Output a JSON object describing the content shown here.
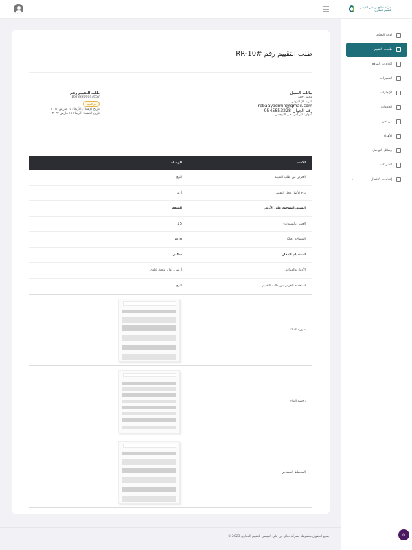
{
  "header": {
    "logo_text": "شركة صالح بن علي العيسى للتقييم العقاري"
  },
  "sidebar": {
    "items": [
      {
        "label": "لوحة التحكم",
        "icon": "dashboard-icon"
      },
      {
        "label": "طلبات التقييم",
        "icon": "list-icon",
        "active": true
      },
      {
        "label": "إعدادات الموقع",
        "icon": "gear-icon"
      },
      {
        "label": "المميزات",
        "icon": "star-icon"
      },
      {
        "label": "الإنجازات",
        "icon": "chart-icon"
      },
      {
        "label": "الخدمات",
        "icon": "tools-icon"
      },
      {
        "label": "من نحن",
        "icon": "info-icon"
      },
      {
        "label": "الأهداف",
        "icon": "target-icon"
      },
      {
        "label": "رسائل التواصل",
        "icon": "message-icon"
      },
      {
        "label": "الشركات",
        "icon": "lock-icon"
      },
      {
        "label": "إعدادات الأعمال",
        "icon": "sliders-icon",
        "chevron": "‹"
      }
    ]
  },
  "page": {
    "title": "طلب التقييم رقم #RR-10"
  },
  "client": {
    "title": "بيانات العميل",
    "name": "محمد أحمد",
    "email_label": "البريد الإلكتروني",
    "email": "rebaayadmin@gmail.com",
    "phone_label": "رقم الجوال",
    "phone": "0545853228",
    "address": "عنوان: الرياض، حي النرجس"
  },
  "request": {
    "title": "طلب التقييم رقم",
    "number": "16788800043657",
    "status": "تم التنفيذ",
    "created": "تاريخ الإنشاء: الأربعاء ١٥ مارس ٢٠٢٣",
    "executed": "تاريخ التنفيذ: الأربعاء ١٥ مارس ٢٠٢٣"
  },
  "table": {
    "headers": [
      "الاسم",
      "الوصف"
    ],
    "rows": [
      {
        "name": "الغرض من طلب التقييم",
        "desc": "البيع",
        "type": "normal"
      },
      {
        "name": "نوع الأصل محل التقييم",
        "desc": "أرض",
        "type": "normal"
      },
      {
        "name": "المبنى الموجود على الأرض",
        "desc": "الشقة",
        "type": "section"
      },
      {
        "name": "العمر (بالسنوات)",
        "desc": "15",
        "type": "number"
      },
      {
        "name": "المساحة (م2)",
        "desc": "400",
        "type": "number"
      },
      {
        "name": "استخدام العقار",
        "desc": "سكني",
        "type": "section"
      },
      {
        "name": "الأدوار والمرافق",
        "desc": "أرضي، أول، ملحق علوي",
        "type": "normal"
      },
      {
        "name": "استخدام الغرض من طلب التقييم",
        "desc": "البيع",
        "type": "normal"
      }
    ],
    "image_rows": [
      {
        "label": "صورة الصك"
      },
      {
        "label": "رخصة البناء"
      },
      {
        "label": "المخطط المساحي"
      }
    ]
  },
  "footer": {
    "text": "جميع الحقوق محفوظة لشركة صالح بن علي العيسى للتقييم العقاري 2023 ©"
  },
  "fab": {
    "label": "0"
  }
}
